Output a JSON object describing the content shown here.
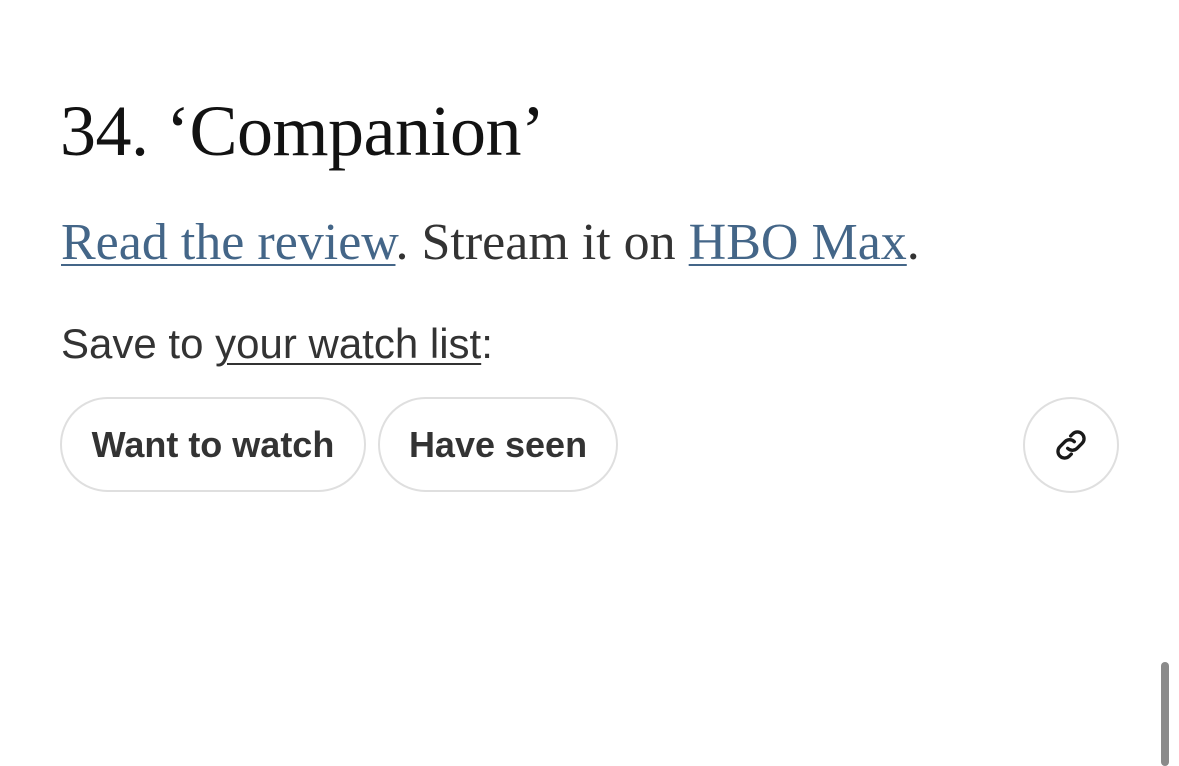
{
  "item": {
    "title": "34. ‘Companion’",
    "review_link": "Read the review",
    "stream_text": ". Stream it on ",
    "service_link": "HBO Max",
    "end_period": "."
  },
  "watchlist": {
    "prefix": "Save to ",
    "link": "your watch list",
    "suffix": ":",
    "want_label": "Want to watch",
    "seen_label": "Have seen"
  },
  "icons": {
    "share": "link-icon"
  },
  "colors": {
    "link": "#446688",
    "text": "#333333",
    "pill_border": "#dfdfdf"
  }
}
